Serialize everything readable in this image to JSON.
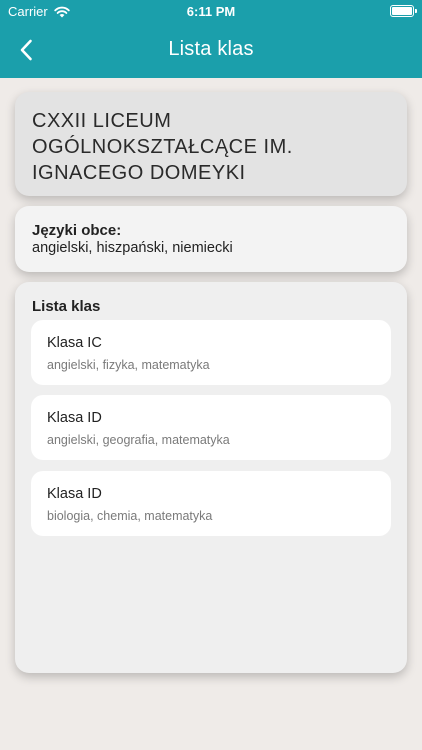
{
  "status_bar": {
    "carrier": "Carrier",
    "time": "6:11 PM",
    "icons": [
      "wifi-icon",
      "battery-icon"
    ]
  },
  "header": {
    "title": "Lista klas",
    "back_icon": "chevron-left-icon",
    "color": "#1b9fab"
  },
  "school": {
    "name": "CXXII LICEUM OGÓLNOKSZTAŁCĄCE IM. IGNACEGO DOMEYKI"
  },
  "languages": {
    "label": "Języki obce:",
    "value": "angielski, hiszpański, niemiecki"
  },
  "classes": {
    "title": "Lista klas",
    "items": [
      {
        "name": "Klasa IC",
        "subjects": "angielski, fizyka, matematyka"
      },
      {
        "name": "Klasa ID",
        "subjects": "angielski, geografia, matematyka"
      },
      {
        "name": "Klasa ID",
        "subjects": "biologia, chemia, matematyka"
      }
    ]
  }
}
